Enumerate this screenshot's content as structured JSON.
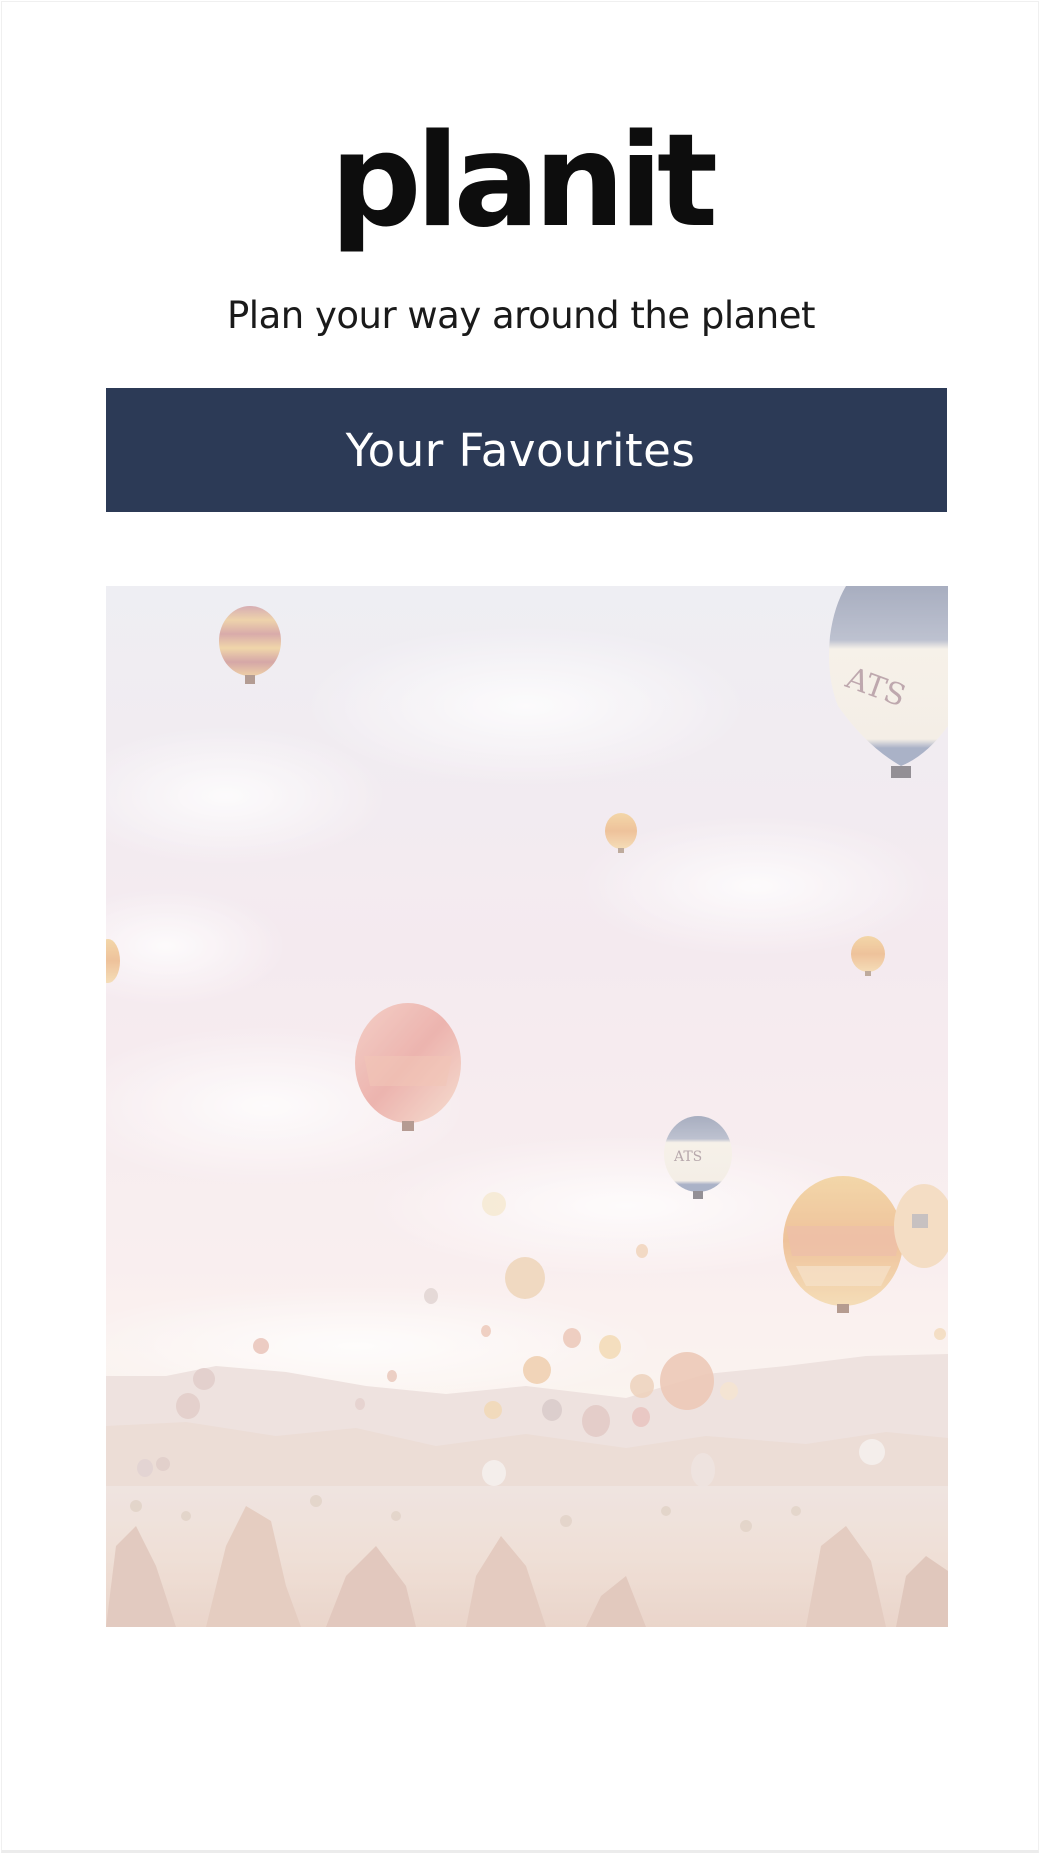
{
  "app": {
    "logo_text": "planit",
    "tagline": "Plan your way around the planet"
  },
  "actions": {
    "favourites_label": "Your Favourites"
  },
  "hero": {
    "subject": "hot-air-balloons-over-valley",
    "balloon_texts": [
      "ATS",
      "ATS"
    ],
    "colors": {
      "sky_top": "#eceaf0",
      "sky_mid": "#f6e7ea",
      "horizon": "#f8efe6",
      "ground": "#ead8cc"
    }
  },
  "theme": {
    "accent": "#2c3a56",
    "text": "#0d0d0d",
    "background": "#ffffff"
  }
}
